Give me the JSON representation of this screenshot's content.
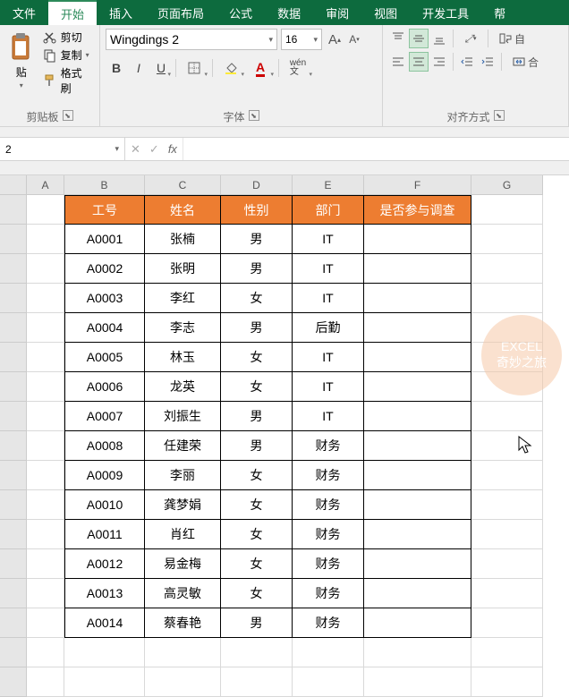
{
  "tabs": {
    "file": "文件",
    "home": "开始",
    "insert": "插入",
    "layout": "页面布局",
    "formula": "公式",
    "data": "数据",
    "review": "审阅",
    "view": "视图",
    "dev": "开发工具",
    "extra": "帮"
  },
  "ribbon": {
    "clipboard": {
      "label": "剪贴板",
      "cut": "剪切",
      "copy": "复制",
      "copy_extra": "▾",
      "format": "格式刷",
      "paste": "贴",
      "paste2": "贴"
    },
    "font": {
      "label": "字体",
      "name": "Wingdings 2",
      "size": "16"
    },
    "align": {
      "label": "对齐方式",
      "wrap": "自",
      "merge": "合"
    }
  },
  "namebox": "2",
  "formula": "",
  "columns": [
    "A",
    "B",
    "C",
    "D",
    "E",
    "F",
    "G"
  ],
  "table": {
    "headers": [
      "工号",
      "姓名",
      "性别",
      "部门",
      "是否参与调查"
    ],
    "rows": [
      [
        "A0001",
        "张楠",
        "男",
        "IT",
        ""
      ],
      [
        "A0002",
        "张明",
        "男",
        "IT",
        ""
      ],
      [
        "A0003",
        "李红",
        "女",
        "IT",
        ""
      ],
      [
        "A0004",
        "李志",
        "男",
        "后勤",
        ""
      ],
      [
        "A0005",
        "林玉",
        "女",
        "IT",
        ""
      ],
      [
        "A0006",
        "龙英",
        "女",
        "IT",
        ""
      ],
      [
        "A0007",
        "刘振生",
        "男",
        "IT",
        ""
      ],
      [
        "A0008",
        "任建荣",
        "男",
        "财务",
        ""
      ],
      [
        "A0009",
        "李丽",
        "女",
        "财务",
        ""
      ],
      [
        "A0010",
        "龚梦娟",
        "女",
        "财务",
        ""
      ],
      [
        "A0011",
        "肖红",
        "女",
        "财务",
        ""
      ],
      [
        "A0012",
        "易金梅",
        "女",
        "财务",
        ""
      ],
      [
        "A0013",
        "高灵敏",
        "女",
        "财务",
        ""
      ],
      [
        "A0014",
        "蔡春艳",
        "男",
        "财务",
        ""
      ]
    ]
  },
  "watermark": {
    "line1": "EXCEL",
    "line2": "奇妙之旅"
  }
}
